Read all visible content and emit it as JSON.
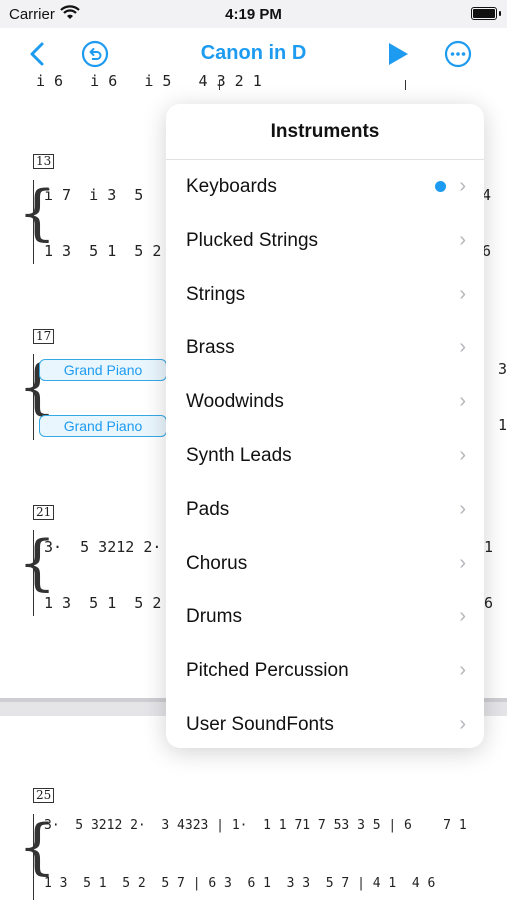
{
  "status_bar": {
    "carrier": "Carrier",
    "time": "4:19 PM"
  },
  "nav": {
    "title": "Canon in D",
    "accent": "#1d9bf0"
  },
  "score": {
    "measure_numbers": [
      "13",
      "17",
      "21",
      "25"
    ],
    "track_labels": [
      "Grand Piano",
      "Grand Piano"
    ],
    "rows": {
      "r0": "i 6   i 6   i 5   4 3 2 1",
      "m13_top": "i 7  i 3  5",
      "m13_bot": "1 3  5 1  5 2",
      "m21_top": "3·  5 3212 2·",
      "m21_bot": "1 3  5 1  5 2",
      "m25_top": "3·  5 3212 2·  3 4323 | 1·  1 1 71 7 53 3 5 | 6    7 1",
      "m25_bot": "1 3  5 1  5 2  5 7 | 6 3  6 1  3 3  5 7 | 4 1  4 6",
      "right_13_top": "4",
      "right_13_bot": "6",
      "right_17_top": "3",
      "right_17_bot": "1",
      "right_21_top": "1",
      "right_21_bot": "6"
    }
  },
  "instruments_menu": {
    "title": "Instruments",
    "items": [
      {
        "label": "Keyboards",
        "selected": true
      },
      {
        "label": "Plucked Strings",
        "selected": false
      },
      {
        "label": "Strings",
        "selected": false
      },
      {
        "label": "Brass",
        "selected": false
      },
      {
        "label": "Woodwinds",
        "selected": false
      },
      {
        "label": "Synth Leads",
        "selected": false
      },
      {
        "label": "Pads",
        "selected": false
      },
      {
        "label": "Chorus",
        "selected": false
      },
      {
        "label": "Drums",
        "selected": false
      },
      {
        "label": "Pitched Percussion",
        "selected": false
      },
      {
        "label": "User SoundFonts",
        "selected": false
      }
    ]
  }
}
